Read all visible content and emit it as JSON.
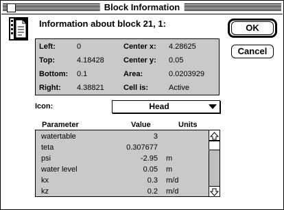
{
  "window": {
    "title": "Block Information"
  },
  "header": {
    "heading": "Information about block 21, 1:"
  },
  "buttons": {
    "ok": "OK",
    "cancel": "Cancel"
  },
  "info": {
    "left_label": "Left:",
    "left_value": "0",
    "top_label": "Top:",
    "top_value": "4.18428",
    "bottom_label": "Bottom:",
    "bottom_value": "0.1",
    "right_label": "Right:",
    "right_value": "4.38821",
    "center_x_label": "Center x:",
    "center_x_value": "4.28625",
    "center_y_label": "Center y:",
    "center_y_value": "0.05",
    "area_label": "Area:",
    "area_value": "0.0203929",
    "cell_is_label": "Cell is:",
    "cell_is_value": "Active"
  },
  "icon_select": {
    "label": "Icon:",
    "value": "Head"
  },
  "table": {
    "columns": [
      "Parameter",
      "Value",
      "Units"
    ],
    "rows": [
      {
        "parameter": "watertable",
        "value": "3",
        "unit": ""
      },
      {
        "parameter": "teta",
        "value": "0.307677",
        "unit": ""
      },
      {
        "parameter": "psi",
        "value": "-2.95",
        "unit": "m"
      },
      {
        "parameter": "water level",
        "value": "0.05",
        "unit": "m"
      },
      {
        "parameter": "kx",
        "value": "0.3",
        "unit": "m/d"
      },
      {
        "parameter": "kz",
        "value": "0.2",
        "unit": "m/d"
      }
    ]
  },
  "icons": {
    "window_icon": "document-info-icon",
    "close": "close-box-icon",
    "popup": "triangle-down-icon",
    "scroll_up": "arrow-up-icon",
    "scroll_down": "arrow-down-icon"
  },
  "colors": {
    "panel": "#c9c9c9",
    "background": "#ffffff",
    "ink": "#000000"
  }
}
